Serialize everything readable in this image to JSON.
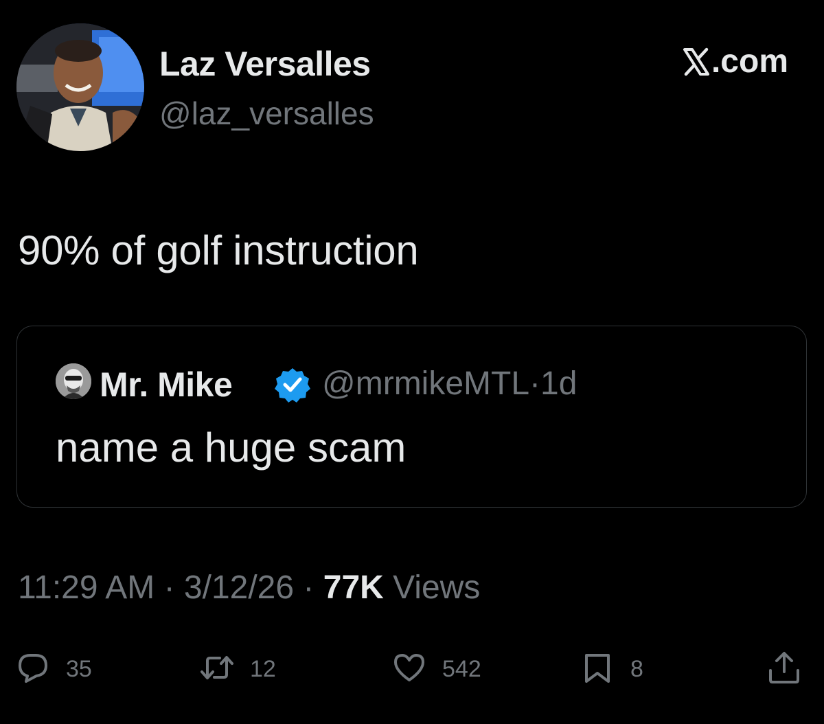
{
  "author": {
    "name": "Laz Versalles",
    "handle": "@laz_versalles"
  },
  "brand": {
    "label": ".com"
  },
  "tweet": {
    "text": "90% of golf instruction"
  },
  "quoted_tweet": {
    "name": "Mr. Mike",
    "handle": "@mrmikeMTL",
    "separator": "·",
    "age": "1d",
    "text": "name a huge scam",
    "verified_color": "#1d9bf0"
  },
  "meta": {
    "time": "11:29 AM",
    "separator": "·",
    "date": "3/12/26",
    "views_count": "77K",
    "views_label": "Views"
  },
  "actions": {
    "reply": {
      "icon": "reply-icon",
      "count": "35"
    },
    "repost": {
      "icon": "repost-icon",
      "count": "12"
    },
    "like": {
      "icon": "heart-icon",
      "count": "542"
    },
    "bookmark": {
      "icon": "bookmark-icon",
      "count": "8"
    },
    "share": {
      "icon": "share-icon"
    }
  },
  "colors": {
    "background": "#000000",
    "primary_text": "#e7e9ea",
    "secondary_text": "#71767b",
    "border": "#2f3336"
  }
}
